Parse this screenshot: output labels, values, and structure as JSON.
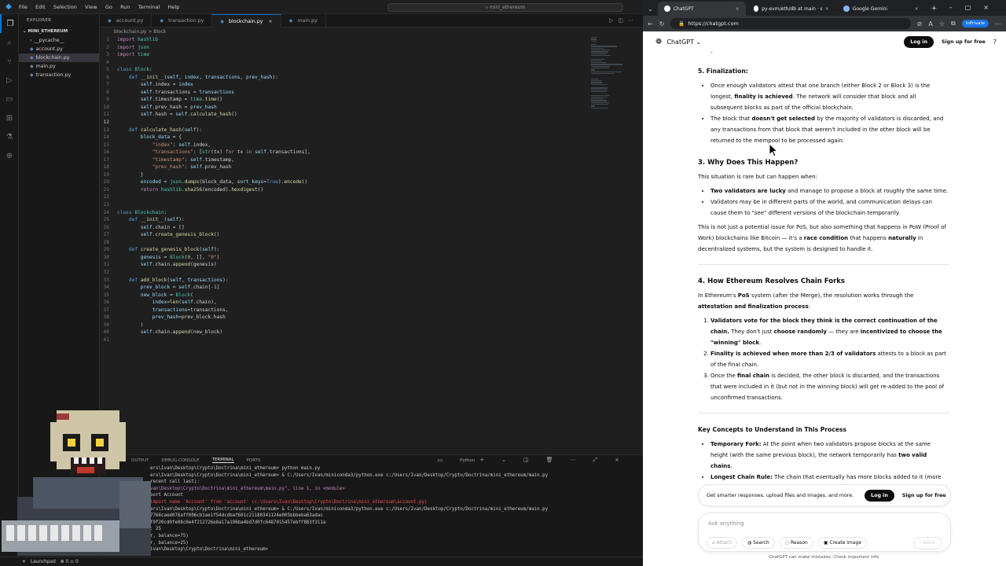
{
  "vscode": {
    "menu": [
      "File",
      "Edit",
      "Selection",
      "View",
      "Go",
      "Run",
      "Terminal",
      "Help"
    ],
    "command_center": "mini_ethereum",
    "explorer_title": "EXPLORER",
    "folder": "MINI_ETHEREUM",
    "files": [
      "__pycache__",
      "account.py",
      "blockchain.py",
      "main.py",
      "transaction.py"
    ],
    "tabs": [
      "account.py",
      "transaction.py",
      "blockchain.py",
      "main.py"
    ],
    "breadcrumb": "blockchain.py > Block",
    "code_lines": [
      [
        {
          "t": "import ",
          "c": "k"
        },
        {
          "t": "hashlib",
          "c": "c"
        }
      ],
      [
        {
          "t": "import ",
          "c": "k"
        },
        {
          "t": "json",
          "c": "c"
        }
      ],
      [
        {
          "t": "import ",
          "c": "k"
        },
        {
          "t": "time",
          "c": "c"
        }
      ],
      [],
      [
        {
          "t": "class ",
          "c": "kb"
        },
        {
          "t": "Block",
          "c": "c"
        },
        {
          "t": ":",
          "c": ""
        }
      ],
      [
        {
          "t": "    def ",
          "c": "kb"
        },
        {
          "t": "__init__",
          "c": "f"
        },
        {
          "t": "(",
          "c": ""
        },
        {
          "t": "self",
          "c": "v"
        },
        {
          "t": ", ",
          "c": ""
        },
        {
          "t": "index",
          "c": "v"
        },
        {
          "t": ", ",
          "c": ""
        },
        {
          "t": "transactions",
          "c": "v"
        },
        {
          "t": ", ",
          "c": ""
        },
        {
          "t": "prev_hash",
          "c": "v"
        },
        {
          "t": "):",
          "c": ""
        }
      ],
      [
        {
          "t": "        self",
          "c": "v"
        },
        {
          "t": ".index = ",
          "c": ""
        },
        {
          "t": "index",
          "c": "v"
        }
      ],
      [
        {
          "t": "        self",
          "c": "v"
        },
        {
          "t": ".transactions = ",
          "c": ""
        },
        {
          "t": "transactions",
          "c": "v"
        }
      ],
      [
        {
          "t": "        self",
          "c": "v"
        },
        {
          "t": ".timestamp = ",
          "c": ""
        },
        {
          "t": "time",
          "c": "c"
        },
        {
          "t": ".",
          "c": ""
        },
        {
          "t": "time",
          "c": "f"
        },
        {
          "t": "()",
          "c": ""
        }
      ],
      [
        {
          "t": "        self",
          "c": "v"
        },
        {
          "t": ".prev_hash = ",
          "c": ""
        },
        {
          "t": "prev_hash",
          "c": "v"
        }
      ],
      [
        {
          "t": "        self",
          "c": "v"
        },
        {
          "t": ".hash = ",
          "c": ""
        },
        {
          "t": "self",
          "c": "v"
        },
        {
          "t": ".",
          "c": ""
        },
        {
          "t": "calculate_hash",
          "c": "f"
        },
        {
          "t": "()",
          "c": ""
        }
      ],
      [],
      [
        {
          "t": "    def ",
          "c": "kb"
        },
        {
          "t": "calculate_hash",
          "c": "f"
        },
        {
          "t": "(",
          "c": ""
        },
        {
          "t": "self",
          "c": "v"
        },
        {
          "t": "):",
          "c": ""
        }
      ],
      [
        {
          "t": "        block_data",
          "c": "v"
        },
        {
          "t": " = {",
          "c": ""
        }
      ],
      [
        {
          "t": "            \"index\"",
          "c": "s"
        },
        {
          "t": ": ",
          "c": ""
        },
        {
          "t": "self",
          "c": "v"
        },
        {
          "t": ".index,",
          "c": ""
        }
      ],
      [
        {
          "t": "            \"transactions\"",
          "c": "s"
        },
        {
          "t": ": [",
          "c": ""
        },
        {
          "t": "str",
          "c": "c"
        },
        {
          "t": "(tx) ",
          "c": ""
        },
        {
          "t": "for",
          "c": "k"
        },
        {
          "t": " tx ",
          "c": ""
        },
        {
          "t": "in",
          "c": "k"
        },
        {
          "t": " ",
          "c": ""
        },
        {
          "t": "self",
          "c": "v"
        },
        {
          "t": ".transactions],",
          "c": ""
        }
      ],
      [
        {
          "t": "            \"timestamp\"",
          "c": "s"
        },
        {
          "t": ": ",
          "c": ""
        },
        {
          "t": "self",
          "c": "v"
        },
        {
          "t": ".timestamp,",
          "c": ""
        }
      ],
      [
        {
          "t": "            \"prev_hash\"",
          "c": "s"
        },
        {
          "t": ": ",
          "c": ""
        },
        {
          "t": "self",
          "c": "v"
        },
        {
          "t": ".prev_hash",
          "c": ""
        }
      ],
      [
        {
          "t": "        }",
          "c": ""
        }
      ],
      [
        {
          "t": "        encoded",
          "c": "v"
        },
        {
          "t": " = ",
          "c": ""
        },
        {
          "t": "json",
          "c": "c"
        },
        {
          "t": ".",
          "c": ""
        },
        {
          "t": "dumps",
          "c": "f"
        },
        {
          "t": "(block_data, ",
          "c": ""
        },
        {
          "t": "sort_keys",
          "c": "v"
        },
        {
          "t": "=",
          "c": ""
        },
        {
          "t": "True",
          "c": "kb"
        },
        {
          "t": ").",
          "c": ""
        },
        {
          "t": "encode",
          "c": "f"
        },
        {
          "t": "()",
          "c": ""
        }
      ],
      [
        {
          "t": "        return ",
          "c": "k"
        },
        {
          "t": "hashlib",
          "c": "c"
        },
        {
          "t": ".",
          "c": ""
        },
        {
          "t": "sha256",
          "c": "f"
        },
        {
          "t": "(encoded).",
          "c": ""
        },
        {
          "t": "hexdigest",
          "c": "f"
        },
        {
          "t": "()",
          "c": ""
        }
      ],
      [],
      [],
      [
        {
          "t": "class ",
          "c": "kb"
        },
        {
          "t": "Blockchain",
          "c": "c"
        },
        {
          "t": ":",
          "c": ""
        }
      ],
      [
        {
          "t": "    def ",
          "c": "kb"
        },
        {
          "t": "__init__",
          "c": "f"
        },
        {
          "t": "(",
          "c": ""
        },
        {
          "t": "self",
          "c": "v"
        },
        {
          "t": "):",
          "c": ""
        }
      ],
      [
        {
          "t": "        self",
          "c": "v"
        },
        {
          "t": ".chain = []",
          "c": ""
        }
      ],
      [
        {
          "t": "        self",
          "c": "v"
        },
        {
          "t": ".",
          "c": ""
        },
        {
          "t": "create_genesis_block",
          "c": "f"
        },
        {
          "t": "()",
          "c": ""
        }
      ],
      [],
      [
        {
          "t": "    def ",
          "c": "kb"
        },
        {
          "t": "create_genesis_block",
          "c": "f"
        },
        {
          "t": "(",
          "c": ""
        },
        {
          "t": "self",
          "c": "v"
        },
        {
          "t": "):",
          "c": ""
        }
      ],
      [
        {
          "t": "        genesis",
          "c": "v"
        },
        {
          "t": " = ",
          "c": ""
        },
        {
          "t": "Block",
          "c": "c"
        },
        {
          "t": "(",
          "c": ""
        },
        {
          "t": "0",
          "c": "n"
        },
        {
          "t": ", [], ",
          "c": ""
        },
        {
          "t": "\"0\"",
          "c": "s"
        },
        {
          "t": ")",
          "c": ""
        }
      ],
      [
        {
          "t": "        self",
          "c": "v"
        },
        {
          "t": ".chain.",
          "c": ""
        },
        {
          "t": "append",
          "c": "f"
        },
        {
          "t": "(genesis)",
          "c": ""
        }
      ],
      [],
      [
        {
          "t": "    def ",
          "c": "kb"
        },
        {
          "t": "add_block",
          "c": "f"
        },
        {
          "t": "(",
          "c": ""
        },
        {
          "t": "self",
          "c": "v"
        },
        {
          "t": ", ",
          "c": ""
        },
        {
          "t": "transactions",
          "c": "v"
        },
        {
          "t": "):",
          "c": ""
        }
      ],
      [
        {
          "t": "        prev_block",
          "c": "v"
        },
        {
          "t": " = ",
          "c": ""
        },
        {
          "t": "self",
          "c": "v"
        },
        {
          "t": ".chain[-",
          "c": ""
        },
        {
          "t": "1",
          "c": "n"
        },
        {
          "t": "]",
          "c": ""
        }
      ],
      [
        {
          "t": "        new_block",
          "c": "v"
        },
        {
          "t": " = ",
          "c": ""
        },
        {
          "t": "Block",
          "c": "c"
        },
        {
          "t": "(",
          "c": ""
        }
      ],
      [
        {
          "t": "            index",
          "c": "v"
        },
        {
          "t": "=",
          "c": ""
        },
        {
          "t": "len",
          "c": "f"
        },
        {
          "t": "(",
          "c": ""
        },
        {
          "t": "self",
          "c": "v"
        },
        {
          "t": ".chain),",
          "c": ""
        }
      ],
      [
        {
          "t": "            transactions",
          "c": "v"
        },
        {
          "t": "=transactions,",
          "c": ""
        }
      ],
      [
        {
          "t": "            prev_hash",
          "c": "v"
        },
        {
          "t": "=prev_block.hash",
          "c": ""
        }
      ],
      [
        {
          "t": "        )",
          "c": ""
        }
      ],
      [
        {
          "t": "        self",
          "c": "v"
        },
        {
          "t": ".chain.",
          "c": ""
        },
        {
          "t": "append",
          "c": "f"
        },
        {
          "t": "(new_block)",
          "c": ""
        }
      ],
      []
    ],
    "current_line": 12,
    "panel_tabs": [
      "OUTPUT",
      "DEBUG CONSOLE",
      "TERMINAL",
      "PORTS"
    ],
    "panel_active": "TERMINAL",
    "terminal_kind": "Python",
    "terminal_lines": [
      {
        "t": "ers\\Ivan\\Desktop\\Crypto\\Doctrina\\mini_ethereum> python main.py",
        "c": ""
      },
      {
        "t": "ers\\Ivan\\Desktop\\Crypto\\Doctrina\\mini_ethereum> & C:/Users/Ivan/miniconda3/python.exe c:/Users/Ivan/Desktop/Crypto/Doctrina/mini_ethereum/main.py",
        "c": ""
      },
      {
        "t": "recent call last):",
        "c": ""
      },
      {
        "t": "van\\Desktop\\Crypto\\Doctrina\\mini_ethereum\\main.py\", line 1, in <module>",
        "c": "warn"
      },
      {
        "t": "port Account",
        "c": ""
      },
      {
        "t": "import name 'Account' from 'account' (c:\\Users\\Ivan\\Desktop\\Crypto\\Doctrina\\mini_ethereum\\account.py)",
        "c": "err"
      },
      {
        "t": "ers\\Ivan\\Desktop\\Crypto\\Doctrina\\mini_ethereum> & C:/Users/Ivan/miniconda3/python.exe c:/Users/Ivan/Desktop/Crypto/Doctrina/mini_ethereum/main.py",
        "c": ""
      },
      {
        "t": "7766caed076aff006cb1ae1f54dcdbaf601c21180341124e005bbbeba63adac",
        "c": ""
      },
      {
        "t": "f9f20cd0fe08c0e4f212726e8a17a196ba4bd7d0fc6487015457ebff883f311a",
        "c": ""
      },
      {
        "t": ": 25",
        "c": ""
      },
      {
        "t": "r, balance=75)",
        "c": ""
      },
      {
        "t": "r, balance=25)",
        "c": ""
      },
      {
        "t": "ivan\\Desktop\\Crypto\\Doctrina\\mini_ethereum> ",
        "c": ""
      }
    ],
    "status": [
      "Launchpad",
      "⊗ 0 ⚠ 0"
    ]
  },
  "browser": {
    "tabs": [
      "ChatGPT",
      "py-evm/eth/db at main · ether...",
      "Google Gemini"
    ],
    "url": "https://chatgpt.com",
    "inprivate": "InPrivate",
    "app_name": "ChatGPT",
    "login": "Log in",
    "signup": "Sign up for free",
    "top_fragment": "one gets more extensions (more blocks added to it).",
    "finalization_title": "5. Finalization:",
    "fin_bullets": [
      [
        {
          "t": "Once enough validators attest that one branch (either Block 2 or Block 3) is the longest, "
        },
        {
          "t": "finality is achieved",
          "b": true
        },
        {
          "t": ". The network will consider that block and all subsequent blocks as part of the official blockchain."
        }
      ],
      [
        {
          "t": "The block that "
        },
        {
          "t": "doesn't get selected",
          "b": true
        },
        {
          "t": " by the majority of validators is discarded, and any transactions from that block that weren't included in the other block will be returned to the mempool to be processed again."
        }
      ]
    ],
    "why_title": "3. Why Does This Happen?",
    "why_intro": "This situation is rare but can happen when:",
    "why_bullets": [
      [
        {
          "t": "Two validators are lucky",
          "b": true
        },
        {
          "t": " and manage to propose a block at roughly the same time."
        }
      ],
      [
        {
          "t": "Validators may be in different parts of the world, and communication delays can cause them to \"see\" different versions of the blockchain temporarily."
        }
      ]
    ],
    "why_para": [
      {
        "t": "This is not just a potential issue for PoS, but also something that happens in PoW (Proof of Work) blockchains like Bitcoin — it's a "
      },
      {
        "t": "race condition",
        "b": true
      },
      {
        "t": " that happens "
      },
      {
        "t": "naturally",
        "b": true
      },
      {
        "t": " in decentralized systems, but the system is designed to handle it."
      }
    ],
    "how_title": "4. How Ethereum Resolves Chain Forks",
    "how_intro": [
      {
        "t": "In Ethereum's "
      },
      {
        "t": "PoS",
        "b": true
      },
      {
        "t": " system (after the Merge), the resolution works through the "
      },
      {
        "t": "attestation and finalization process",
        "b": true
      },
      {
        "t": ":"
      }
    ],
    "how_items": [
      [
        {
          "t": "Validators vote for the block they think is the correct continuation of the chain.",
          "b": true
        },
        {
          "t": " They don't just "
        },
        {
          "t": "choose randomly",
          "b": true
        },
        {
          "t": " — they are "
        },
        {
          "t": "incentivized to choose the \"winning\" block",
          "b": true
        },
        {
          "t": "."
        }
      ],
      [
        {
          "t": "Finality is achieved when more than 2/3 of validators",
          "b": true
        },
        {
          "t": " attests to a block as part of the final chain."
        }
      ],
      [
        {
          "t": "Once the "
        },
        {
          "t": "final chain",
          "b": true
        },
        {
          "t": " is decided, the other block is discarded, and the transactions that were included in it (but not in the winning block) will get re-added to the pool of unconfirmed transactions."
        }
      ]
    ],
    "key_title": "Key Concepts to Understand in This Process",
    "key_bullets": [
      [
        {
          "t": "Temporary Fork:",
          "b": true
        },
        {
          "t": " At the point when two validators propose blocks at the same height (with the same previous block), the network temporarily has "
        },
        {
          "t": "two valid chains",
          "b": true
        },
        {
          "t": "."
        }
      ],
      [
        {
          "t": "Longest Chain Rule:",
          "b": true
        },
        {
          "t": " The chain that eventually has more blocks added to it (more"
        }
      ]
    ],
    "banner_text": "Get smarter responses, upload files and images, and more.",
    "input_placeholder": "Ask anything",
    "tools": [
      "Attach",
      "Search",
      "Reason",
      "Create image"
    ],
    "voice": "Voice",
    "footnote": "ChatGPT can make mistakes. Check important info."
  }
}
